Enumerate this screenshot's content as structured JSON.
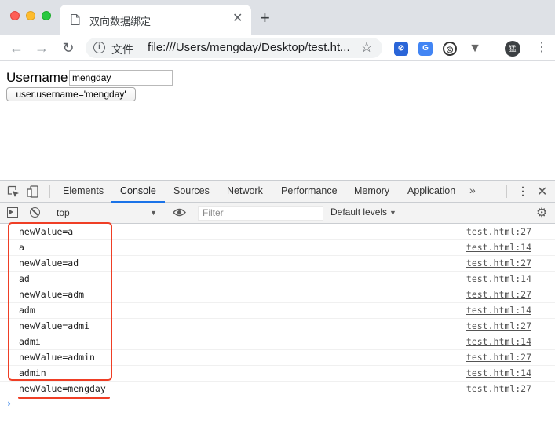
{
  "browser": {
    "tab_title": "双向数据绑定",
    "tab_close": "✕",
    "new_tab": "+",
    "omnibox_label": "文件",
    "url": "file:///Users/mengday/Desktop/test.ht...",
    "avatar_text": "猛"
  },
  "page": {
    "username_label": "Username",
    "username_value": "mengday",
    "set_button_label": "user.username='mengday'"
  },
  "devtools": {
    "tabs": [
      "Elements",
      "Console",
      "Sources",
      "Network",
      "Performance",
      "Memory",
      "Application"
    ],
    "active_tab": "Console",
    "more": "»",
    "context": "top",
    "filter_placeholder": "Filter",
    "levels": "Default levels",
    "logs": [
      {
        "msg": "newValue=a",
        "src": "test.html:27"
      },
      {
        "msg": "a",
        "src": "test.html:14"
      },
      {
        "msg": "newValue=ad",
        "src": "test.html:27"
      },
      {
        "msg": "ad",
        "src": "test.html:14"
      },
      {
        "msg": "newValue=adm",
        "src": "test.html:27"
      },
      {
        "msg": "adm",
        "src": "test.html:14"
      },
      {
        "msg": "newValue=admi",
        "src": "test.html:27"
      },
      {
        "msg": "admi",
        "src": "test.html:14"
      },
      {
        "msg": "newValue=admin",
        "src": "test.html:27"
      },
      {
        "msg": "admin",
        "src": "test.html:14"
      },
      {
        "msg": "newValue=mengday",
        "src": "test.html:27"
      }
    ],
    "prompt": "›"
  },
  "colors": {
    "annotation": "#ef3e25",
    "active_tab_underline": "#1a73e8"
  }
}
